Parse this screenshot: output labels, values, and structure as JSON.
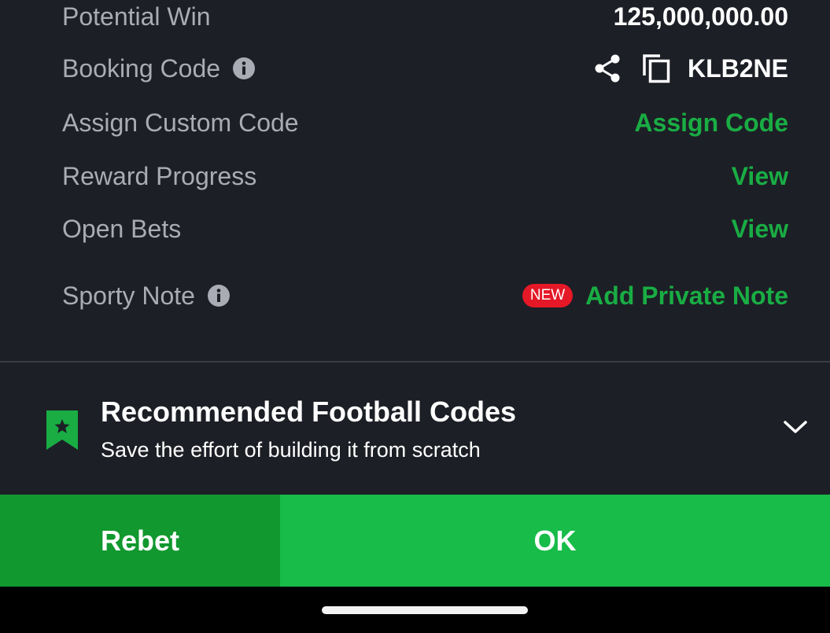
{
  "rows": {
    "potential_win": {
      "label": "Potential Win",
      "value": "125,000,000.00"
    },
    "booking_code": {
      "label": "Booking Code",
      "value": "KLB2NE"
    },
    "custom_code": {
      "label": "Assign Custom Code",
      "action": "Assign Code"
    },
    "reward_progress": {
      "label": "Reward Progress",
      "action": "View"
    },
    "open_bets": {
      "label": "Open Bets",
      "action": "View"
    },
    "sporty_note": {
      "label": "Sporty Note",
      "badge": "NEW",
      "action": "Add Private Note"
    }
  },
  "recommended": {
    "title": "Recommended Football Codes",
    "subtitle": "Save the effort of building it from scratch"
  },
  "buttons": {
    "rebet": "Rebet",
    "ok": "OK"
  },
  "icons": {
    "info": "info-icon",
    "share": "share-icon",
    "copy": "copy-icon",
    "bookmark": "bookmark-star-icon",
    "expand": "chevron-down-icon"
  },
  "colors": {
    "background": "#1d1f26",
    "accent_green": "#19ad44",
    "ok_button": "#18bc49",
    "rebet_button": "#11982f",
    "badge_red": "#e41827"
  }
}
